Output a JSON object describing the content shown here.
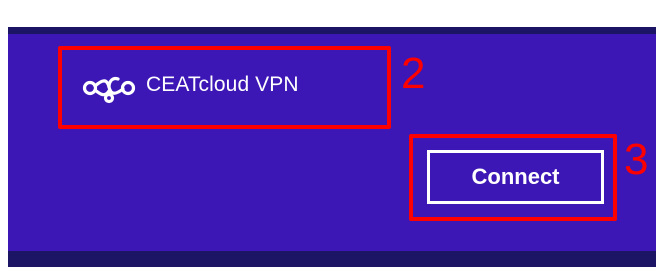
{
  "network_list": {
    "item": {
      "name": "CEATcloud VPN",
      "icon": "vpn-connection-icon"
    },
    "connect_button_label": "Connect"
  },
  "annotations": {
    "callout_2": "2",
    "callout_3": "3",
    "color": "#ff0000"
  },
  "colors": {
    "panel": "#3c17b5",
    "bar": "#1c1464",
    "text": "#ffffff"
  }
}
